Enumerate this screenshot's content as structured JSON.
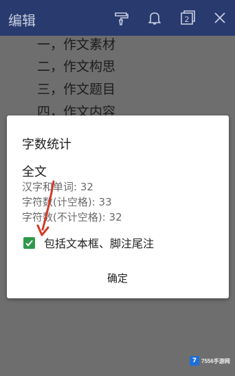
{
  "topbar": {
    "title": "编辑",
    "icons": [
      "format-painter-icon",
      "bell-icon",
      "window-count-icon",
      "close-icon"
    ],
    "window_count": "2"
  },
  "document": {
    "lines": [
      "一，作文素材",
      "二，作文构思",
      "三，作文题目",
      "四，作文内容"
    ]
  },
  "dialog": {
    "title": "字数统计",
    "section": "全文",
    "stats": [
      "汉字和单词: 32",
      "字符数(计空格): 33",
      "字符数(不计空格): 32"
    ],
    "checkbox_label": "包括文本框、脚注尾注",
    "checkbox_checked": true,
    "ok_label": "确定"
  },
  "colors": {
    "topbar": "#283a6e",
    "checkbox": "#2e9a4a",
    "arrow": "#d23a2a"
  },
  "watermark": {
    "logo_text": "7",
    "text": "7556手游网"
  }
}
